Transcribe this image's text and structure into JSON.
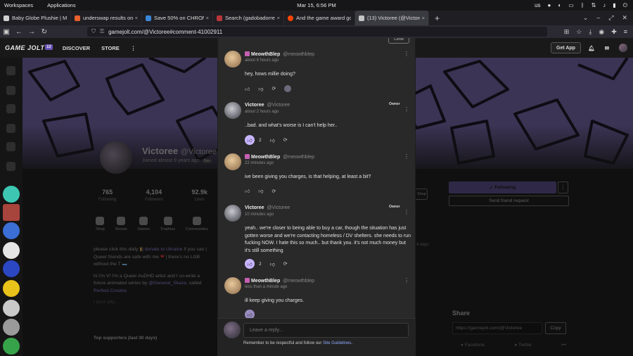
{
  "os": {
    "menu": [
      "Workspaces",
      "Applications"
    ],
    "clock": "Mar 15, 6:56 PM",
    "keyboard": "us"
  },
  "tabs": [
    {
      "title": "Baby Globe Plushie | Ma",
      "color": "#d0d0d0"
    },
    {
      "title": "underswap results on St",
      "color": "#e8602c"
    },
    {
      "title": "Save 50% on CHRONO T",
      "color": "#3a86d8"
    },
    {
      "title": "Search (gadobadorrer)",
      "color": "#b8363a"
    },
    {
      "title": "And the game award go",
      "color": "#ff4500"
    },
    {
      "title": "(13) Victoree (@Victoree",
      "color": "#c4c4c4"
    }
  ],
  "url": "gamejolt.com/@Victoree#comment-41002911",
  "site": {
    "logo": "GAME JOLT",
    "logo_badge": "12",
    "nav": [
      "DISCOVER",
      "STORE"
    ],
    "get_app": "Get App"
  },
  "profile": {
    "name": "Victoree",
    "handle": "@Victoree",
    "joined": "Joined almost 9 years ago",
    "tag": "Dev",
    "stats": [
      {
        "value": "765",
        "label": "Following"
      },
      {
        "value": "4,104",
        "label": "Followers"
      },
      {
        "value": "92.9k",
        "label": "Likes"
      }
    ],
    "links": [
      "Shop",
      "Shouts",
      "Games",
      "Trophies",
      "Communities"
    ],
    "bio": {
      "line1a": "please click this daily",
      "line1b": "donate to Ukraine",
      "line1c": "if you can | Queer friends are safe with me",
      "line1d": "| there's no LGB without the T",
      "line2a": "hi I'm V! I'm a Queer AuDHD artist and I co-write a future animated series by",
      "line2b": "@General_Skaze",
      "line2c": "called",
      "line2d": "Perfect Crootox",
      "line3": "I post silly..."
    },
    "top_supporters": "Top supporters (last 30 days)",
    "shop_button": "Shop",
    "days": "4 days",
    "following_button": "Following",
    "friend_request": "Send friend request",
    "share_title": "Share",
    "share_url": "https://gamejolt.com/@Victoree",
    "copy": "Copy",
    "social": [
      "Facebook",
      "Twitter"
    ]
  },
  "modal": {
    "close": "Close",
    "comments": [
      {
        "name": "MeowthBlep",
        "handle": "@meowthblep",
        "time": "about 8 hours ago",
        "body": "hey, hows millie doing?",
        "owner": "",
        "likes": ""
      },
      {
        "name": "Victoree",
        "handle": "@Victoree",
        "time": "about 2 hours ago",
        "body": "..bad. and what's worse is I can't help her..",
        "owner": "Owner",
        "likes": "2"
      },
      {
        "name": "MeowthBlep",
        "handle": "@meowthblep",
        "time": "22 minutes ago",
        "body": "ive been giving you charges, is that helping, at least a bit?",
        "owner": "",
        "likes": ""
      },
      {
        "name": "Victoree",
        "handle": "@Victoree",
        "time": "10 minutes ago",
        "body": "yeah.. we're closer to being able to buy a car, though the situation has just gotten worse and we're contacting homeless / DV shelters. she needs to run fucking NOW. I hate this so much.. but thank you. it's not much money but it's still something",
        "owner": "Owner",
        "likes": "2"
      },
      {
        "name": "MeowthBlep",
        "handle": "@meowthblep",
        "time": "less than a minute ago",
        "body": "ill keep giving you charges.",
        "owner": "",
        "likes": ""
      }
    ],
    "reply_placeholder": "Leave a reply...",
    "rules_text": "Remember to be respectful and follow our",
    "rules_link": "Site Guidelines",
    "rules_end": "."
  }
}
